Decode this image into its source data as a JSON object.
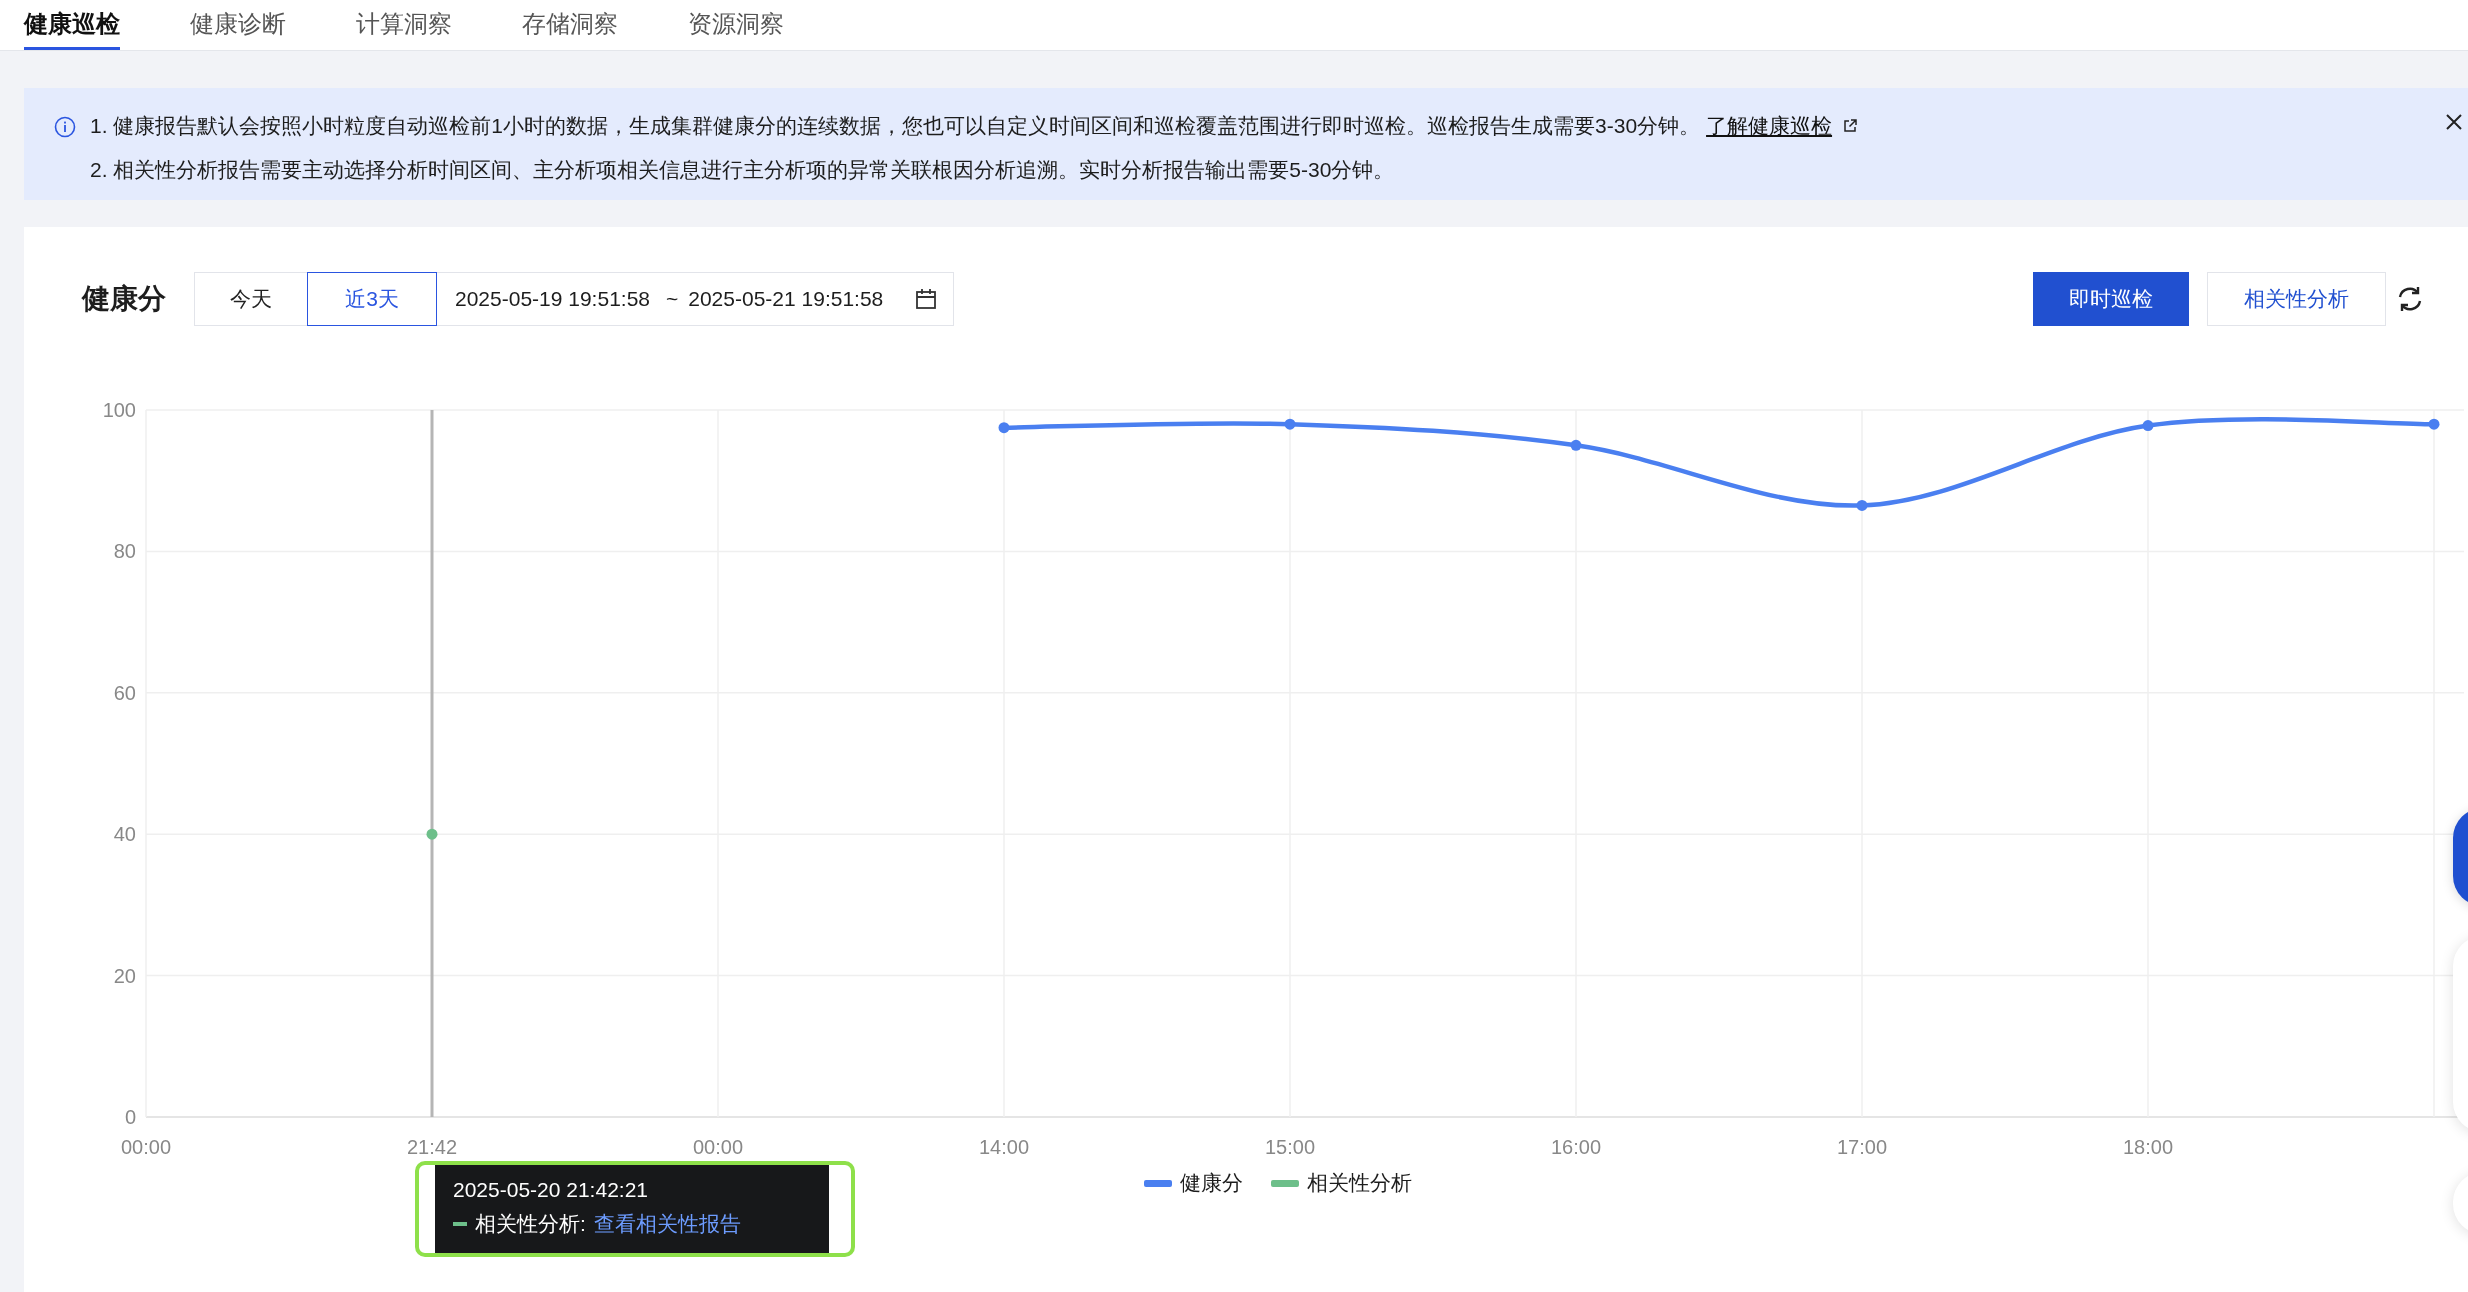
{
  "tabs": [
    {
      "label": "健康巡检",
      "selected": true
    },
    {
      "label": "健康诊断",
      "selected": false
    },
    {
      "label": "计算洞察",
      "selected": false
    },
    {
      "label": "存储洞察",
      "selected": false
    },
    {
      "label": "资源洞察",
      "selected": false
    }
  ],
  "notice": {
    "lines": [
      {
        "text": "1. 健康报告默认会按照小时粒度自动巡检前1小时的数据，生成集群健康分的连续数据，您也可以自定义时间区间和巡检覆盖范围进行即时巡检。巡检报告生成需要3-30分钟。",
        "link": "了解健康巡检"
      },
      {
        "text": "2. 相关性分析报告需要主动选择分析时间区间、主分析项相关信息进行主分析项的异常关联根因分析追溯。实时分析报告输出需要5-30分钟。"
      }
    ]
  },
  "health_score": {
    "title": "健康分",
    "ranges": [
      {
        "label": "今天",
        "selected": false
      },
      {
        "label": "近3天",
        "selected": true
      }
    ],
    "date_range": {
      "start": "2025-05-19 19:51:58",
      "separator": "~",
      "end": "2025-05-21 19:51:58"
    },
    "buttons": [
      {
        "label": "即时巡检",
        "kind": "primary"
      },
      {
        "label": "相关性分析",
        "kind": "secondary"
      }
    ],
    "chart_data": {
      "type": "line",
      "categories": [
        "00:00",
        "21:42",
        "00:00",
        "14:00",
        "15:00",
        "16:00",
        "17:00",
        "18:00",
        null
      ],
      "ylim": [
        0,
        100
      ],
      "yticks": [
        0,
        20,
        40,
        60,
        80,
        100
      ],
      "grid": true,
      "legend": true,
      "series": [
        {
          "name": "健康分",
          "color": "#4a7ff0",
          "marker": true,
          "values": [
            null,
            null,
            null,
            97.5,
            98,
            95,
            86.5,
            97.8,
            98
          ]
        },
        {
          "name": "相关性分析",
          "color": "#6dbf8a",
          "marker": true,
          "values": [
            null,
            40,
            null,
            null,
            null,
            null,
            null,
            null,
            null
          ]
        }
      ],
      "ref_lines": [
        {
          "axis": "x",
          "value": "21:42",
          "color": "#b5b5b5"
        }
      ]
    },
    "tooltip": {
      "time": "2025-05-20 21:42:21",
      "label": "相关性分析:",
      "link": "查看相关性报告"
    }
  }
}
